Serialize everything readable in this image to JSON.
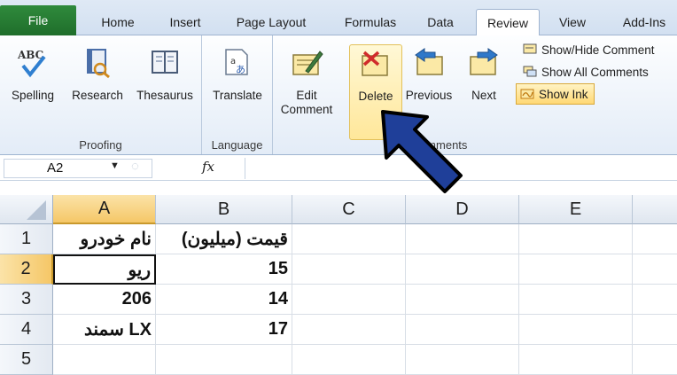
{
  "tabs": [
    "File",
    "Home",
    "Insert",
    "Page Layout",
    "Formulas",
    "Data",
    "Review",
    "View",
    "Add-Ins"
  ],
  "active_tab": "Review",
  "ribbon": {
    "proofing": {
      "label": "Proofing",
      "spelling": "Spelling",
      "research": "Research",
      "thesaurus": "Thesaurus"
    },
    "language": {
      "label": "Language",
      "translate": "Translate"
    },
    "comments": {
      "label": "Comments",
      "edit_line1": "Edit",
      "edit_line2": "Comment",
      "delete": "Delete",
      "previous": "Previous",
      "next": "Next",
      "show_hide": "Show/Hide Comment",
      "show_all": "Show All Comments",
      "show_ink": "Show Ink"
    }
  },
  "formula_bar": {
    "name_box": "A2",
    "fx": "fx",
    "value": ""
  },
  "sheet": {
    "columns": [
      "A",
      "B",
      "C",
      "D",
      "E"
    ],
    "rows": [
      "1",
      "2",
      "3",
      "4",
      "5"
    ],
    "cells": {
      "A1": "نام خودرو",
      "B1": "قیمت (میلیون)",
      "A2": "ریو",
      "B2": "15",
      "A3": "206",
      "B3": "14",
      "A4": "سمند LX",
      "B4": "17"
    },
    "selected_cell": "A2"
  },
  "colors": {
    "file_tab": "#2f8a3c",
    "highlight": "#ffe79a",
    "arrow": "#1f3f99"
  }
}
